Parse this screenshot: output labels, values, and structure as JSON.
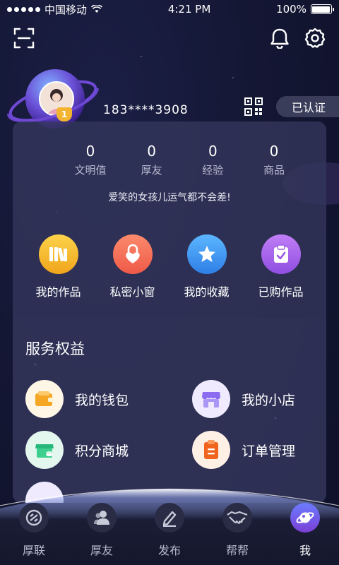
{
  "status_bar": {
    "carrier": "中国移动",
    "time": "4:21 PM",
    "battery": "100%",
    "battery_level": 1.0
  },
  "header": {
    "scan_icon": "scan-icon",
    "bell_icon": "bell-icon",
    "gear_icon": "gear-icon"
  },
  "profile": {
    "level_badge": "1",
    "phone": "183****3908",
    "verified_label": "已认证"
  },
  "stats": [
    {
      "value": "0",
      "label": "文明值"
    },
    {
      "value": "0",
      "label": "厚友"
    },
    {
      "value": "0",
      "label": "经验"
    },
    {
      "value": "0",
      "label": "商品"
    }
  ],
  "motto": "爱笑的女孩儿运气都不会差!",
  "shortcuts": [
    {
      "label": "我的作品",
      "icon": "books-icon",
      "color": "#f5b82a"
    },
    {
      "label": "私密小窗",
      "icon": "lock-icon",
      "color": "#f26b55"
    },
    {
      "label": "我的收藏",
      "icon": "star-icon",
      "color": "#3b96f0"
    },
    {
      "label": "已购作品",
      "icon": "clipboard-check-icon",
      "color": "#a460ea"
    }
  ],
  "services": {
    "title": "服务权益",
    "items": [
      {
        "label": "我的钱包",
        "icon": "wallet-icon"
      },
      {
        "label": "我的小店",
        "icon": "store-icon"
      },
      {
        "label": "积分商城",
        "icon": "points-mall-icon"
      },
      {
        "label": "订单管理",
        "icon": "order-icon"
      }
    ]
  },
  "tabs": [
    {
      "label": "厚联",
      "icon": "link-icon",
      "active": false
    },
    {
      "label": "厚友",
      "icon": "friends-icon",
      "active": false
    },
    {
      "label": "发布",
      "icon": "pen-icon",
      "active": false
    },
    {
      "label": "帮帮",
      "icon": "handshake-icon",
      "active": false
    },
    {
      "label": "我",
      "icon": "planet-icon",
      "active": true
    }
  ]
}
